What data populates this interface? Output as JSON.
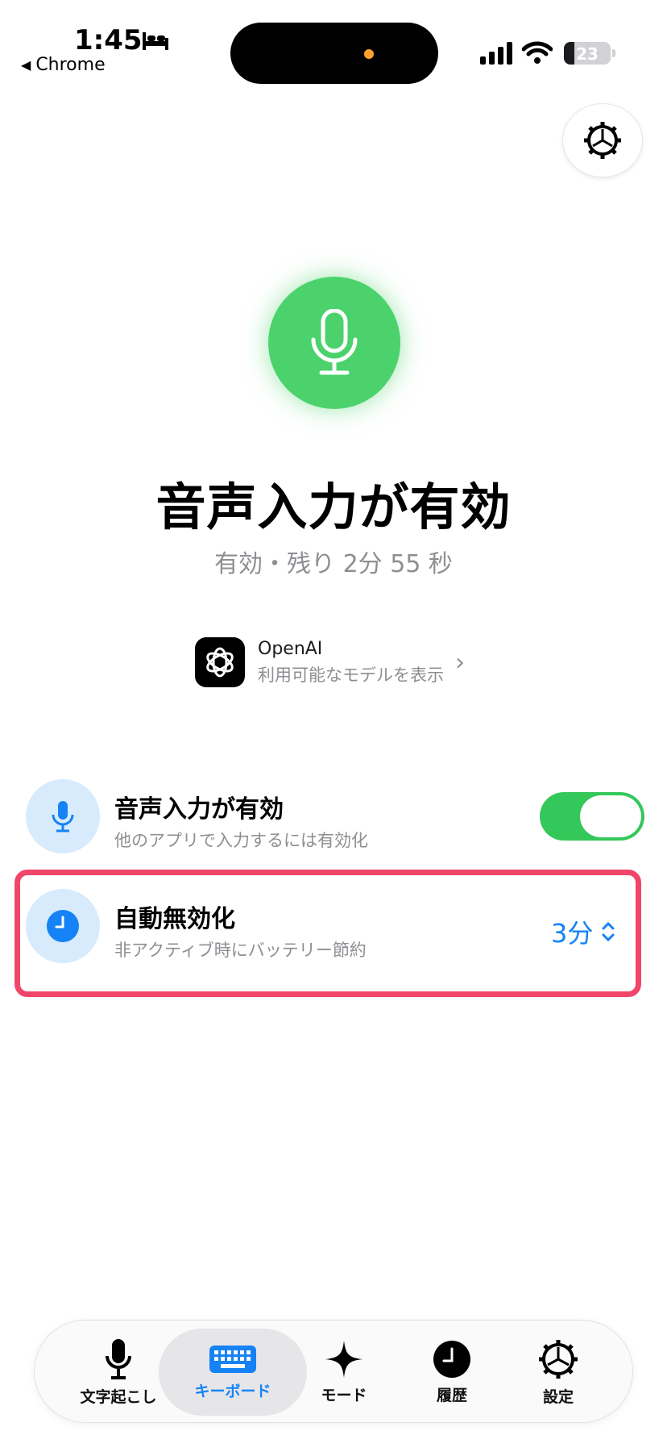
{
  "status_bar": {
    "time": "1:45",
    "back_app": "Chrome",
    "battery": "23"
  },
  "hero": {
    "title": "音声入力が有効",
    "subtitle": "有効・残り 2分 55 秒"
  },
  "provider": {
    "name": "OpenAI",
    "subtitle": "利用可能なモデルを表示"
  },
  "voice_row": {
    "title": "音声入力が有効",
    "subtitle": "他のアプリで入力するには有効化",
    "enabled": true
  },
  "auto_disable_row": {
    "title": "自動無効化",
    "subtitle": "非アクティブ時にバッテリー節約",
    "value": "3分"
  },
  "tabs": [
    {
      "label": "文字起こし",
      "icon": "mic-icon",
      "active": false
    },
    {
      "label": "キーボード",
      "icon": "keyboard-icon",
      "active": true
    },
    {
      "label": "モード",
      "icon": "sparkle-icon",
      "active": false
    },
    {
      "label": "履歴",
      "icon": "clock-icon",
      "active": false
    },
    {
      "label": "設定",
      "icon": "gear-icon",
      "active": false
    }
  ],
  "colors": {
    "accent": "#1583f5",
    "green": "#4cd26c",
    "highlight": "#f0466a"
  }
}
